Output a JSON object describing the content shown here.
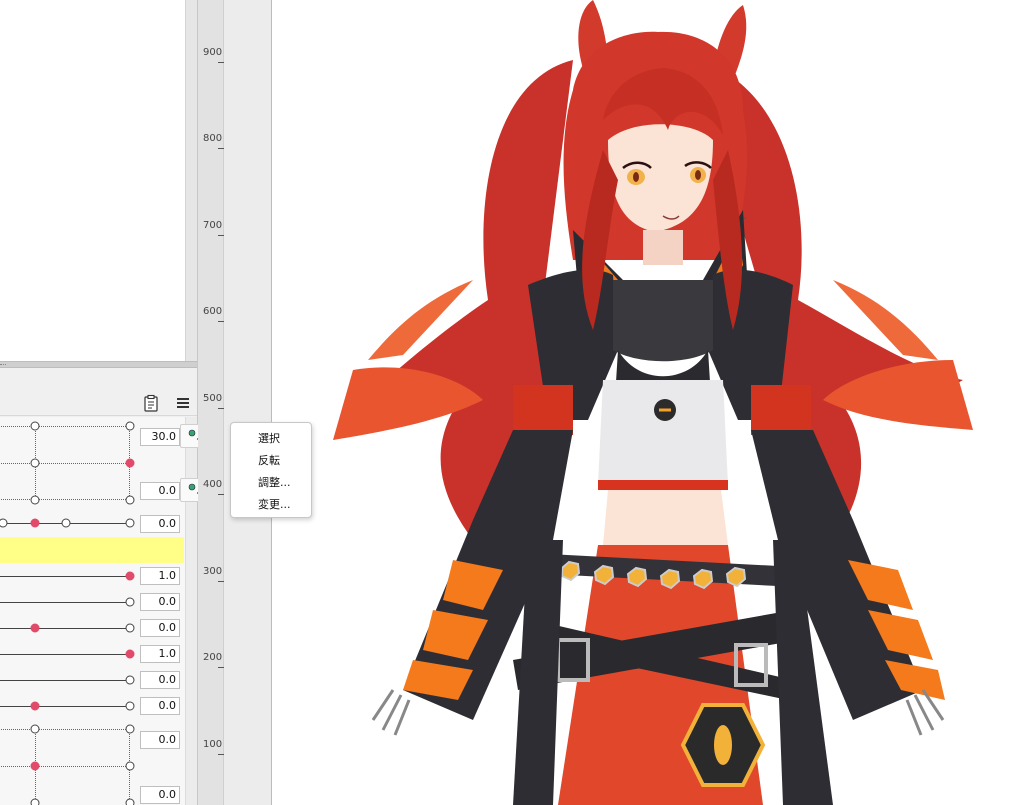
{
  "context_menu": {
    "items": [
      {
        "label": "選択"
      },
      {
        "label": "反転"
      },
      {
        "label": "調整..."
      },
      {
        "label": "変更..."
      }
    ]
  },
  "params": {
    "values": [
      "30.0",
      "0.0",
      "0.0",
      "1.0",
      "0.0",
      "0.0",
      "1.0",
      "0.0",
      "0.0",
      "0.0",
      "0.0"
    ]
  },
  "ruler": {
    "labels": [
      "900",
      "800",
      "700",
      "600",
      "500",
      "400",
      "300",
      "200",
      "100"
    ]
  },
  "colors": {
    "accent_red": "#e24a6a",
    "highlight_yellow": "#ffff88"
  },
  "icons": {
    "toolbar": [
      "clipboard-icon",
      "hamburger-menu-icon"
    ],
    "key_buttons": [
      "add-key-icon",
      "remove-key-icon"
    ]
  }
}
